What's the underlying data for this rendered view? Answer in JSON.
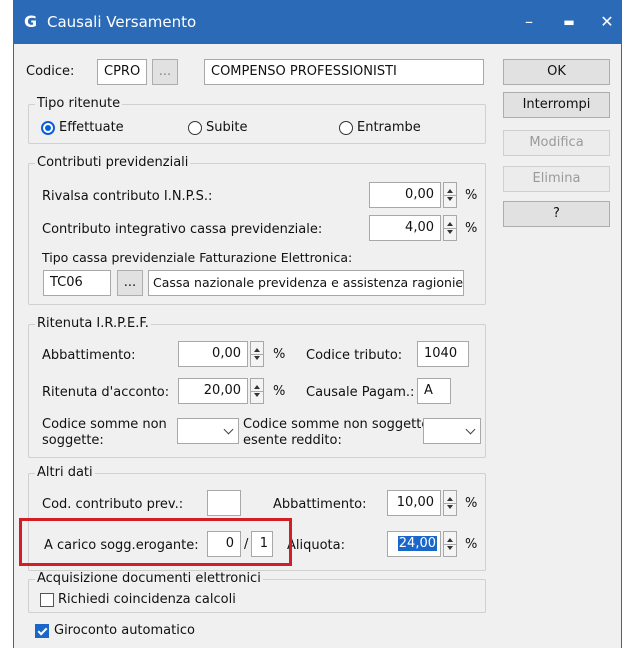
{
  "window": {
    "logo": "G",
    "title": "Causali Versamento",
    "min": "–",
    "max": "▬",
    "close": "✕"
  },
  "header": {
    "codice_label": "Codice:",
    "codice_value": "CPRO",
    "lookup": "...",
    "description": "COMPENSO PROFESSIONISTI"
  },
  "buttons": {
    "ok": "OK",
    "interrompi": "Interrompi",
    "modifica": "Modifica",
    "elimina": "Elimina",
    "help": "?"
  },
  "tipo_ritenute": {
    "title": "Tipo ritenute",
    "options": [
      "Effettuate",
      "Subite",
      "Entrambe"
    ],
    "selected": "Effettuate"
  },
  "contributi": {
    "title": "Contributi previdenziali",
    "rivalsa_label": "Rivalsa contributo I.N.P.S.:",
    "rivalsa_value": "0,00",
    "integrativo_label": "Contributo integrativo cassa previdenziale:",
    "integrativo_value": "4,00",
    "percent": "%",
    "tipo_cassa_label": "Tipo cassa previdenziale Fatturazione Elettronica:",
    "tipo_cassa_code": "TC06",
    "tipo_cassa_lookup": "...",
    "tipo_cassa_desc": "Cassa nazionale previdenza e assistenza ragionie"
  },
  "irpef": {
    "title": "Ritenuta I.R.P.E.F.",
    "abbattimento_label": "Abbattimento:",
    "abbattimento_value": "0,00",
    "codice_tributo_label": "Codice tributo:",
    "codice_tributo_value": "1040",
    "ritenuta_label": "Ritenuta d'acconto:",
    "ritenuta_value": "20,00",
    "causale_label": "Causale Pagam.:",
    "causale_value": "A",
    "non_soggette_label_1": "Codice somme non",
    "non_soggette_label_2": "soggette:",
    "esente_label_1": "Codice somme non soggette",
    "esente_label_2": "esente reddito:",
    "percent": "%"
  },
  "altri": {
    "title": "Altri dati",
    "cod_contributo_label": "Cod. contributo prev.:",
    "cod_contributo_value": "",
    "abbattimento_label": "Abbattimento:",
    "abbattimento_value": "10,00",
    "carico_label": "A carico sogg.erogante:",
    "carico_num": "0",
    "carico_sep": "/",
    "carico_den": "1",
    "aliquota_label": "Aliquota:",
    "aliquota_value": "24,00",
    "percent": "%"
  },
  "acquisizione": {
    "title": "Acquisizione documenti elettronici",
    "richiedi_label": "Richiedi coincidenza calcoli",
    "richiedi_checked": false
  },
  "giroconto": {
    "label": "Giroconto automatico",
    "checked": true
  },
  "colors": {
    "titlebar": "#2b6ab7",
    "highlight": "#d21f27",
    "selection": "#1b66c9"
  }
}
